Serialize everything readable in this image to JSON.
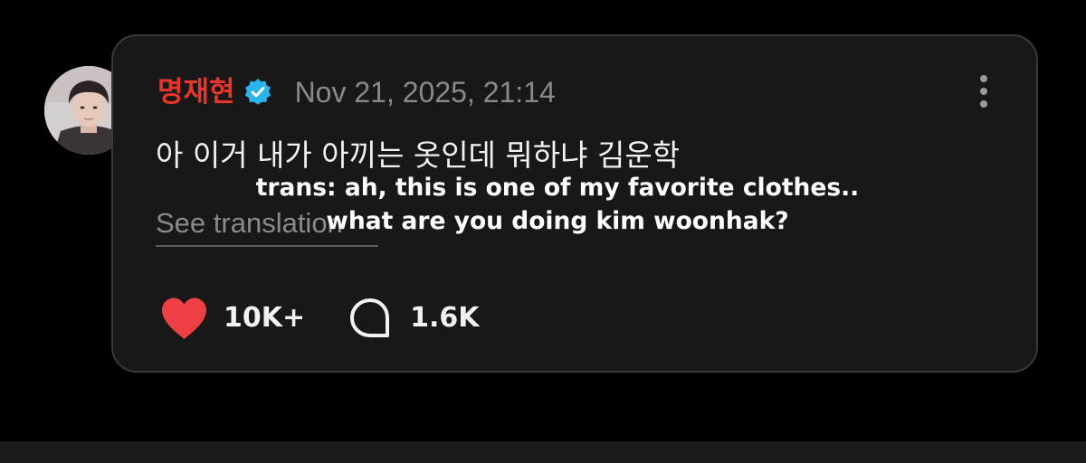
{
  "post": {
    "author": "명재현",
    "verified_icon": "verified-badge-icon",
    "timestamp": "Nov 21, 2025, 21:14",
    "text": "아 이거 내가 아끼는 옷인데 뭐하냐 김운학",
    "see_translation": "See translation",
    "more_icon": "more-vertical-icon"
  },
  "overlay": {
    "line1": "trans: ah, this is one of my favorite clothes..",
    "line2": "what are you doing kim woonhak?"
  },
  "actions": {
    "likes": {
      "icon": "heart-icon",
      "count": "10K+"
    },
    "comments": {
      "icon": "comment-icon",
      "count": "1.6K"
    }
  },
  "colors": {
    "author": "#e8352c",
    "verified": "#2bb3ec",
    "heart": "#ee3f45",
    "card_bg": "#181818",
    "page_bg": "#000000"
  }
}
